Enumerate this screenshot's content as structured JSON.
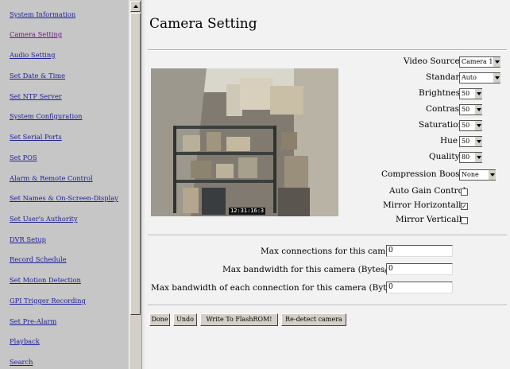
{
  "nav": {
    "items": [
      {
        "label": "System Information"
      },
      {
        "label": "Camera Setting"
      },
      {
        "label": "Audio Setting"
      },
      {
        "label": "Set Date & Time"
      },
      {
        "label": "Set NTP Server"
      },
      {
        "label": "System Configuration"
      },
      {
        "label": "Set Serial Ports"
      },
      {
        "label": "Set POS"
      },
      {
        "label": "Alarm & Remote Control"
      },
      {
        "label": "Set Names & On-Screen-Display"
      },
      {
        "label": "Set User's Authority"
      },
      {
        "label": "DVR Setup"
      },
      {
        "label": "Record Schedule"
      },
      {
        "label": "Set Motion Detection"
      },
      {
        "label": "GPI Trigger Recording"
      },
      {
        "label": "Set Pre-Alarm"
      },
      {
        "label": "Playback"
      },
      {
        "label": "Search"
      }
    ]
  },
  "main": {
    "title": "Camera Setting",
    "preview_timestamp": "12:31:16:3",
    "video_source": {
      "label": "Video Source",
      "value": "Camera 1"
    },
    "standard": {
      "label": "Standard",
      "value": "Auto"
    },
    "brightness": {
      "label": "Brightness",
      "value": "50"
    },
    "contrast": {
      "label": "Contrast",
      "value": "50"
    },
    "saturation": {
      "label": "Saturation",
      "value": "50"
    },
    "hue": {
      "label": "Hue",
      "value": "50"
    },
    "quality": {
      "label": "Quality",
      "value": "80"
    },
    "compression_boost": {
      "label": "Compression Boost:",
      "value": "None"
    },
    "auto_gain": {
      "label": "Auto Gain Control",
      "checked": false
    },
    "mirror_h": {
      "label": "Mirror Horizontally",
      "checked": true
    },
    "mirror_v": {
      "label": "Mirror Vertically",
      "checked": false
    },
    "max_connections": {
      "label": "Max connections for this camera:",
      "value": "0"
    },
    "max_bandwidth": {
      "label": "Max bandwidth for this camera (Bytes/sec):",
      "value": "0"
    },
    "max_bandwidth_each": {
      "label": "Max bandwidth of each connection for this camera (Bytes/sec):",
      "value": "0"
    }
  },
  "buttons": {
    "done": "Done",
    "undo": "Undo",
    "write": "Write To FlashROM!",
    "redetect": "Re-detect camera"
  },
  "colors": {
    "link": "#1d1d99",
    "visited_link": "#6a1a86",
    "nav_bg": "#c6c6c6",
    "main_bg": "#f2f2f2"
  }
}
